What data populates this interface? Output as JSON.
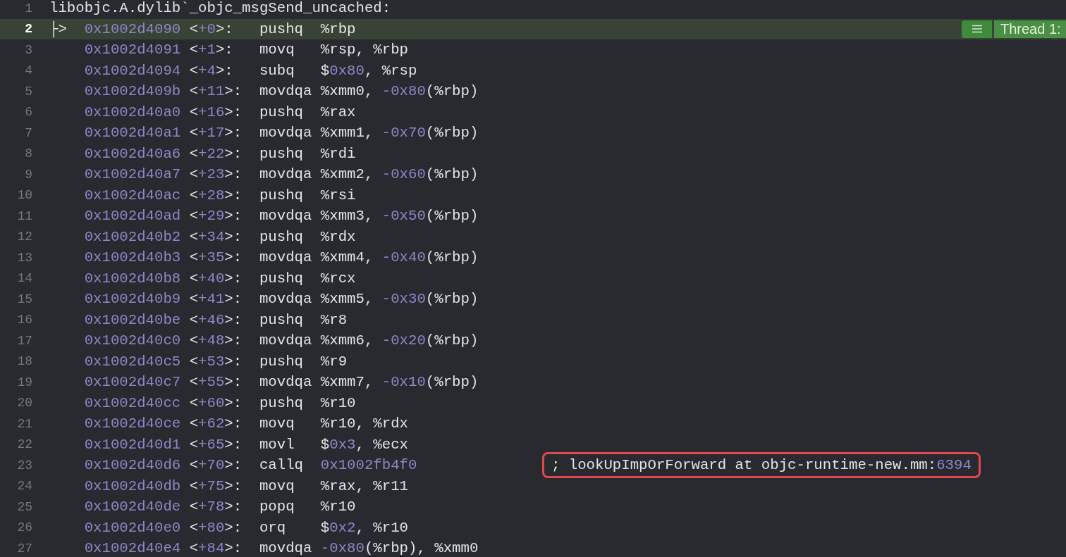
{
  "disassembly": {
    "lines": [
      {
        "number": "1",
        "kind": "label",
        "current": false,
        "text": "libobjc.A.dylib`_objc_msgSend_uncached:"
      },
      {
        "number": "2",
        "kind": "instruction",
        "current": true,
        "marker": "├>",
        "address": "0x1002d4090",
        "offset": "<+0>:",
        "mnemonic": "pushq",
        "operands": "%rbp",
        "thread_badge": {
          "label": "Thread 1:"
        }
      },
      {
        "number": "3",
        "kind": "instruction",
        "current": false,
        "address": "0x1002d4091",
        "offset": "<+1>:",
        "mnemonic": "movq",
        "operands": "%rsp, %rbp"
      },
      {
        "number": "4",
        "kind": "instruction",
        "current": false,
        "address": "0x1002d4094",
        "offset": "<+4>:",
        "mnemonic": "subq",
        "operands": "$0x80, %rsp"
      },
      {
        "number": "5",
        "kind": "instruction",
        "current": false,
        "address": "0x1002d409b",
        "offset": "<+11>:",
        "mnemonic": "movdqa",
        "operands": "%xmm0, -0x80(%rbp)"
      },
      {
        "number": "6",
        "kind": "instruction",
        "current": false,
        "address": "0x1002d40a0",
        "offset": "<+16>:",
        "mnemonic": "pushq",
        "operands": "%rax"
      },
      {
        "number": "7",
        "kind": "instruction",
        "current": false,
        "address": "0x1002d40a1",
        "offset": "<+17>:",
        "mnemonic": "movdqa",
        "operands": "%xmm1, -0x70(%rbp)"
      },
      {
        "number": "8",
        "kind": "instruction",
        "current": false,
        "address": "0x1002d40a6",
        "offset": "<+22>:",
        "mnemonic": "pushq",
        "operands": "%rdi"
      },
      {
        "number": "9",
        "kind": "instruction",
        "current": false,
        "address": "0x1002d40a7",
        "offset": "<+23>:",
        "mnemonic": "movdqa",
        "operands": "%xmm2, -0x60(%rbp)"
      },
      {
        "number": "10",
        "kind": "instruction",
        "current": false,
        "address": "0x1002d40ac",
        "offset": "<+28>:",
        "mnemonic": "pushq",
        "operands": "%rsi"
      },
      {
        "number": "11",
        "kind": "instruction",
        "current": false,
        "address": "0x1002d40ad",
        "offset": "<+29>:",
        "mnemonic": "movdqa",
        "operands": "%xmm3, -0x50(%rbp)"
      },
      {
        "number": "12",
        "kind": "instruction",
        "current": false,
        "address": "0x1002d40b2",
        "offset": "<+34>:",
        "mnemonic": "pushq",
        "operands": "%rdx"
      },
      {
        "number": "13",
        "kind": "instruction",
        "current": false,
        "address": "0x1002d40b3",
        "offset": "<+35>:",
        "mnemonic": "movdqa",
        "operands": "%xmm4, -0x40(%rbp)"
      },
      {
        "number": "14",
        "kind": "instruction",
        "current": false,
        "address": "0x1002d40b8",
        "offset": "<+40>:",
        "mnemonic": "pushq",
        "operands": "%rcx"
      },
      {
        "number": "15",
        "kind": "instruction",
        "current": false,
        "address": "0x1002d40b9",
        "offset": "<+41>:",
        "mnemonic": "movdqa",
        "operands": "%xmm5, -0x30(%rbp)"
      },
      {
        "number": "16",
        "kind": "instruction",
        "current": false,
        "address": "0x1002d40be",
        "offset": "<+46>:",
        "mnemonic": "pushq",
        "operands": "%r8"
      },
      {
        "number": "17",
        "kind": "instruction",
        "current": false,
        "address": "0x1002d40c0",
        "offset": "<+48>:",
        "mnemonic": "movdqa",
        "operands": "%xmm6, -0x20(%rbp)"
      },
      {
        "number": "18",
        "kind": "instruction",
        "current": false,
        "address": "0x1002d40c5",
        "offset": "<+53>:",
        "mnemonic": "pushq",
        "operands": "%r9"
      },
      {
        "number": "19",
        "kind": "instruction",
        "current": false,
        "address": "0x1002d40c7",
        "offset": "<+55>:",
        "mnemonic": "movdqa",
        "operands": "%xmm7, -0x10(%rbp)"
      },
      {
        "number": "20",
        "kind": "instruction",
        "current": false,
        "address": "0x1002d40cc",
        "offset": "<+60>:",
        "mnemonic": "pushq",
        "operands": "%r10"
      },
      {
        "number": "21",
        "kind": "instruction",
        "current": false,
        "address": "0x1002d40ce",
        "offset": "<+62>:",
        "mnemonic": "movq",
        "operands": "%r10, %rdx"
      },
      {
        "number": "22",
        "kind": "instruction",
        "current": false,
        "address": "0x1002d40d1",
        "offset": "<+65>:",
        "mnemonic": "movl",
        "operands": "$0x3, %ecx"
      },
      {
        "number": "23",
        "kind": "instruction",
        "current": false,
        "address": "0x1002d40d6",
        "offset": "<+70>:",
        "mnemonic": "callq",
        "operands": "0x1002fb4f0",
        "comment": {
          "text": "; lookUpImpOrForward at objc-runtime-new.mm:6394",
          "outlined": true
        }
      },
      {
        "number": "24",
        "kind": "instruction",
        "current": false,
        "address": "0x1002d40db",
        "offset": "<+75>:",
        "mnemonic": "movq",
        "operands": "%rax, %r11"
      },
      {
        "number": "25",
        "kind": "instruction",
        "current": false,
        "address": "0x1002d40de",
        "offset": "<+78>:",
        "mnemonic": "popq",
        "operands": "%r10"
      },
      {
        "number": "26",
        "kind": "instruction",
        "current": false,
        "address": "0x1002d40e0",
        "offset": "<+80>:",
        "mnemonic": "orq",
        "operands": "$0x2, %r10"
      },
      {
        "number": "27",
        "kind": "instruction",
        "current": false,
        "address": "0x1002d40e4",
        "offset": "<+84>:",
        "mnemonic": "movdqa",
        "operands": "-0x80(%rbp), %xmm0"
      }
    ]
  }
}
